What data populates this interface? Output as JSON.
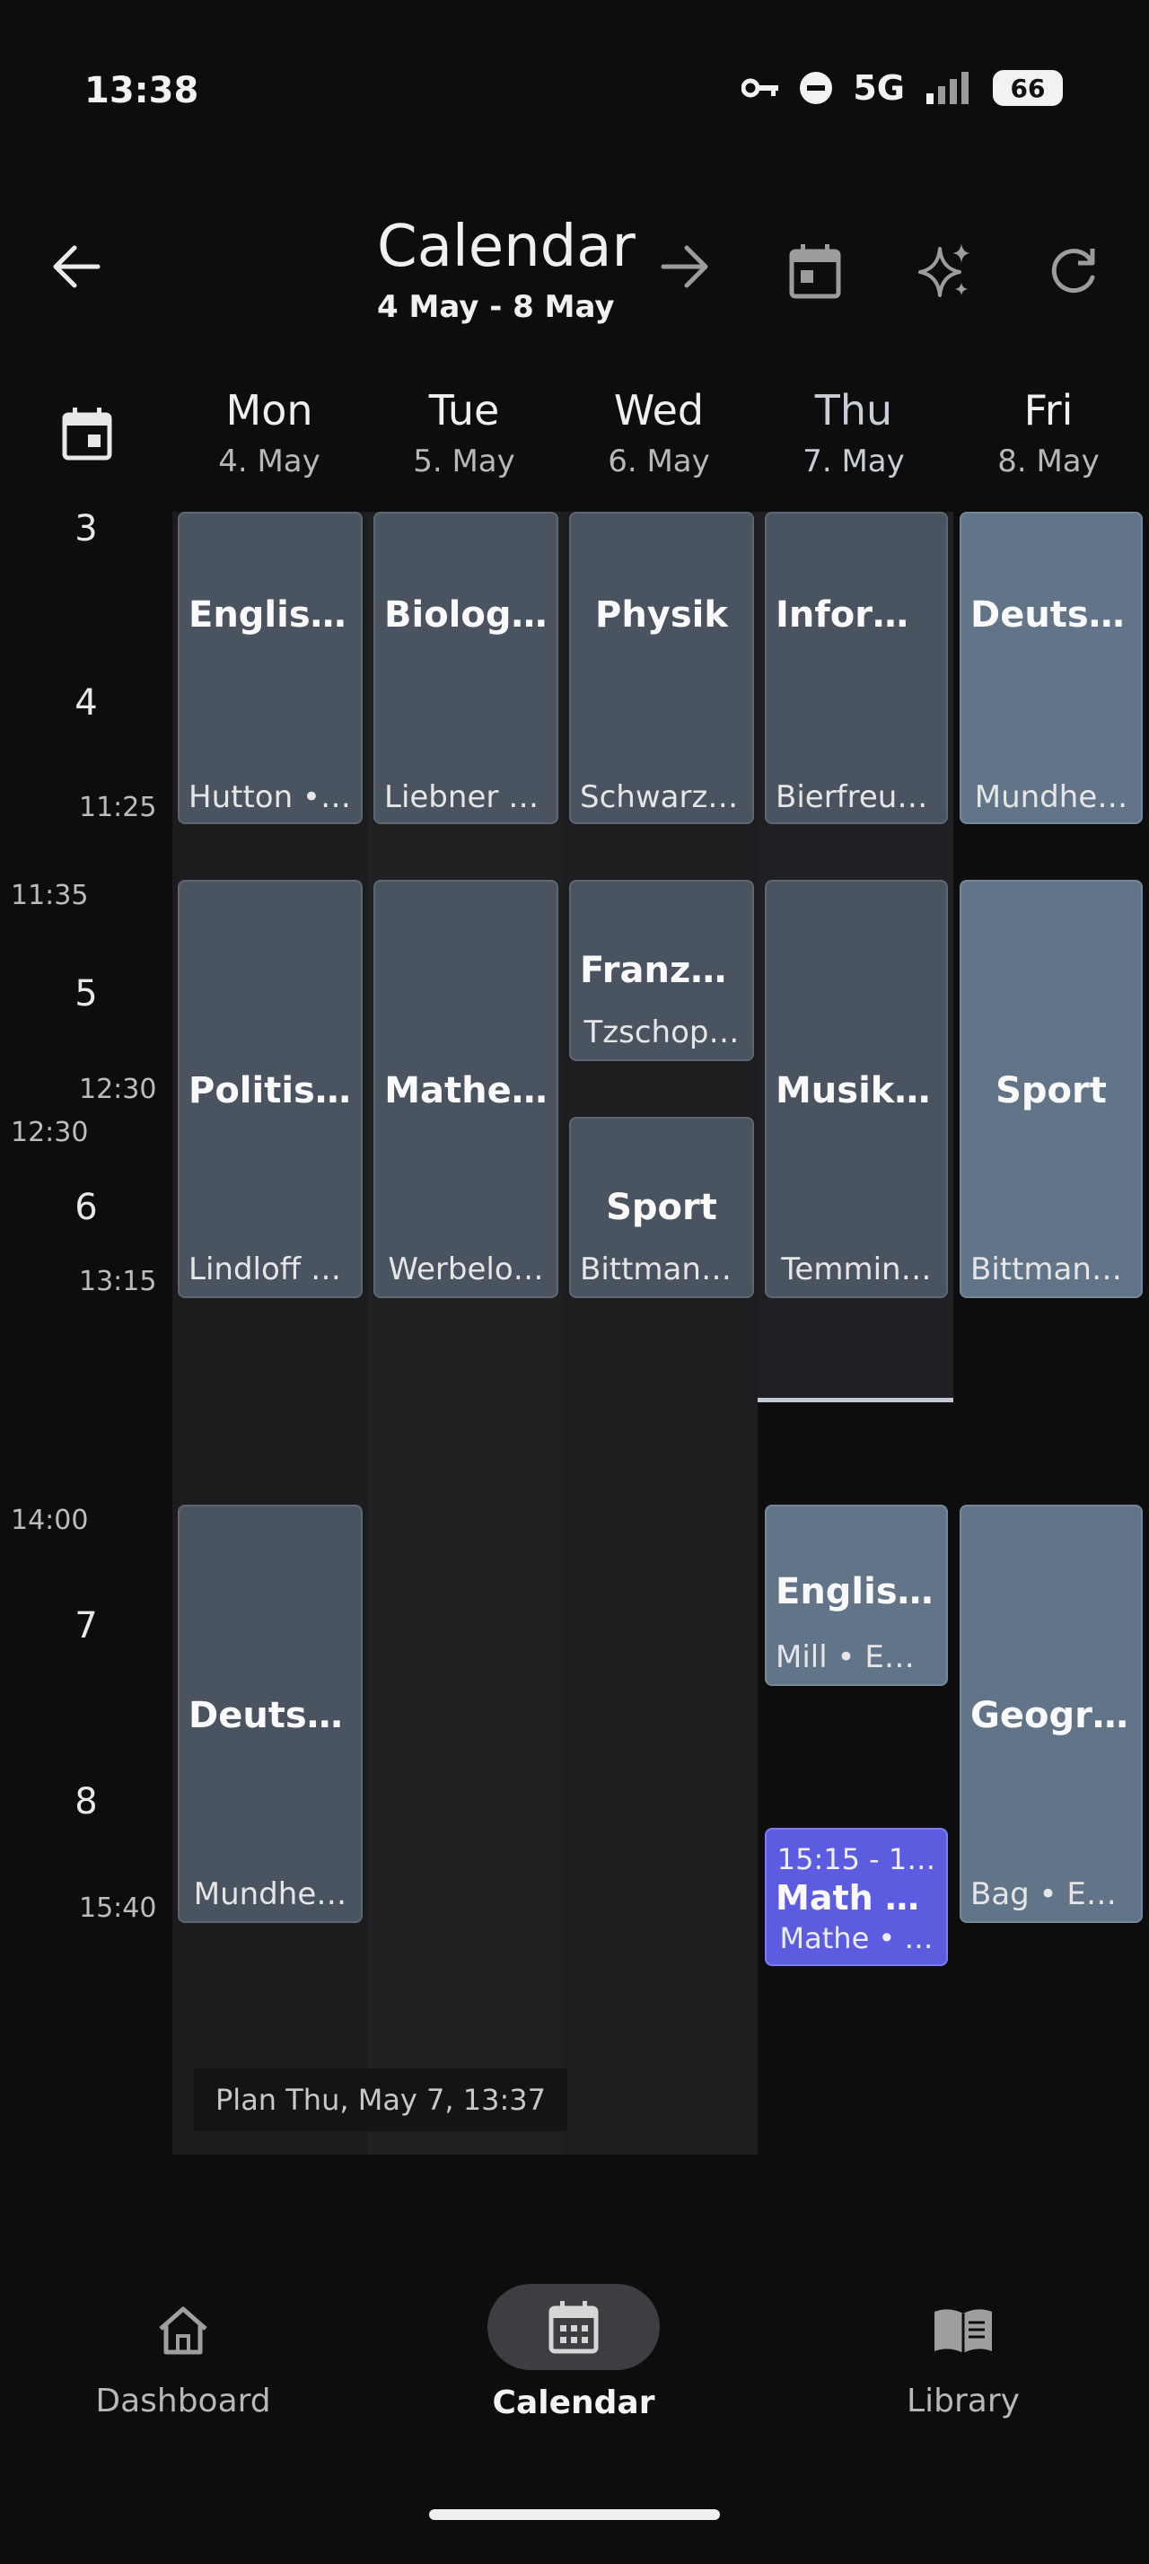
{
  "status": {
    "time": "13:38",
    "network": "5G",
    "battery": "66"
  },
  "header": {
    "title": "Calendar",
    "range": "4 May - 8 May"
  },
  "days": [
    {
      "name": "Mon",
      "date": "4. May"
    },
    {
      "name": "Tue",
      "date": "5. May"
    },
    {
      "name": "Wed",
      "date": "6. May"
    },
    {
      "name": "Thu",
      "date": "7. May"
    },
    {
      "name": "Fri",
      "date": "8. May"
    }
  ],
  "time_axis": {
    "hours": [
      "3",
      "4",
      "5",
      "6",
      "7",
      "8"
    ],
    "times": [
      "11:25",
      "11:35",
      "12:30",
      "12:30",
      "13:15",
      "14:00",
      "15:40"
    ]
  },
  "lessons": {
    "mon": [
      {
        "title": "Englisc…",
        "sub": "Hutton • …"
      },
      {
        "title": "Politisc…",
        "sub": "Lindloff •…"
      },
      {
        "title": "Deutsch",
        "sub": "Mundhe…"
      }
    ],
    "tue": [
      {
        "title": "Biologie",
        "sub": "Liebner •…"
      },
      {
        "title": "Mathe…",
        "sub": "Werbelo…"
      }
    ],
    "wed": [
      {
        "title": "Physik",
        "sub": "Schwarz …"
      },
      {
        "title": "Franzö…",
        "sub": "Tzschop…"
      },
      {
        "title": "Sport",
        "sub": "Bittmann…"
      }
    ],
    "thu": [
      {
        "title": "Inform…",
        "sub": "Bierfreun…"
      },
      {
        "title": "Musik …",
        "sub": "Temmin…"
      },
      {
        "title": "Englisch",
        "sub": "Mill • EN …"
      },
      {
        "time": "15:15 - 1…",
        "title": "Math h…",
        "sub": "Mathe • …"
      }
    ],
    "fri": [
      {
        "title": "Deutsch",
        "sub": "Mundhe…"
      },
      {
        "title": "Sport",
        "sub": "Bittmann…"
      },
      {
        "title": "Geogra…",
        "sub": "Bag • EK …"
      }
    ]
  },
  "plan_note": "Plan Thu, May 7, 13:37",
  "nav": [
    {
      "label": "Dashboard",
      "icon": "home-icon"
    },
    {
      "label": "Calendar",
      "icon": "calendar-icon"
    },
    {
      "label": "Library",
      "icon": "book-icon"
    }
  ]
}
